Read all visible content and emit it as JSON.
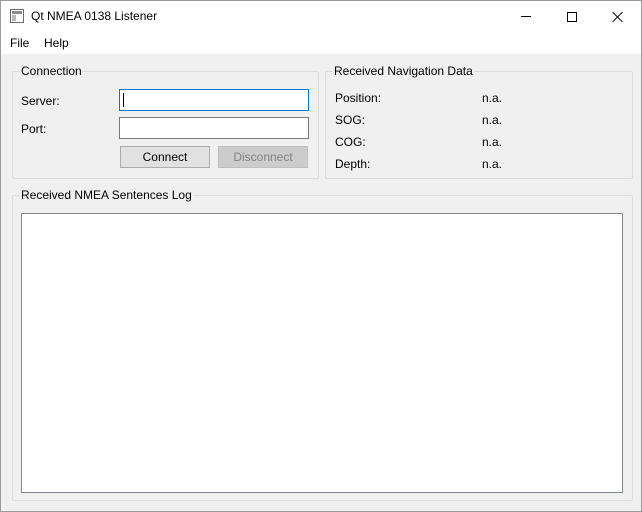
{
  "window": {
    "title": "Qt NMEA 0138 Listener",
    "icon": "app-window-icon",
    "controls": [
      "minimize-icon",
      "maximize-icon",
      "close-icon"
    ]
  },
  "menubar": {
    "file": "File",
    "help": "Help"
  },
  "connection": {
    "title": "Connection",
    "server_label": "Server:",
    "server_value": "",
    "port_label": "Port:",
    "port_value": "",
    "connect_label": "Connect",
    "disconnect_label": "Disconnect",
    "disconnect_enabled": false
  },
  "navigation": {
    "title": "Received Navigation Data",
    "rows": [
      {
        "label": "Position:",
        "value": "n.a."
      },
      {
        "label": "SOG:",
        "value": "n.a."
      },
      {
        "label": "COG:",
        "value": "n.a."
      },
      {
        "label": "Depth:",
        "value": "n.a."
      }
    ]
  },
  "log": {
    "title": "Received NMEA Sentences Log",
    "content": ""
  },
  "colors": {
    "window_bg": "#f0f0f0",
    "focus_border": "#0078d7",
    "disabled_text": "#838383"
  }
}
